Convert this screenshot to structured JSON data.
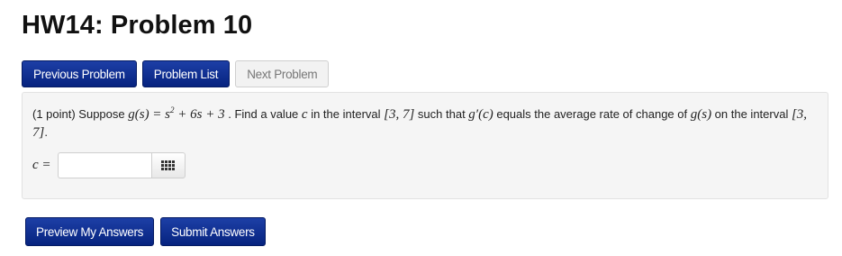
{
  "page": {
    "title": "HW14: Problem 10"
  },
  "nav": {
    "previous_label": "Previous Problem",
    "list_label": "Problem List",
    "next_label": "Next Problem"
  },
  "problem": {
    "points": "(1 point) Suppose ",
    "fn_def": "g(s) = s",
    "fn_exp": "2",
    "fn_rest": " + 6s + 3",
    "text_a": " . Find a value ",
    "var_c": "c",
    "text_b": " in the interval ",
    "interval": "[3, 7]",
    "text_c": " such that ",
    "deriv": "g′(c)",
    "text_d": " equals the average rate of change of ",
    "gs": "g(s)",
    "text_e": " on the interval ",
    "interval2": "[3, 7]",
    "text_f": "."
  },
  "answer": {
    "label": "c =",
    "value": "",
    "palette_icon": "grid-icon"
  },
  "actions": {
    "preview_label": "Preview My Answers",
    "submit_label": "Submit Answers"
  },
  "colors": {
    "primary_button": "#0a2a8c",
    "disabled_button": "#f2f2f2",
    "problem_background": "#f5f5f5"
  }
}
